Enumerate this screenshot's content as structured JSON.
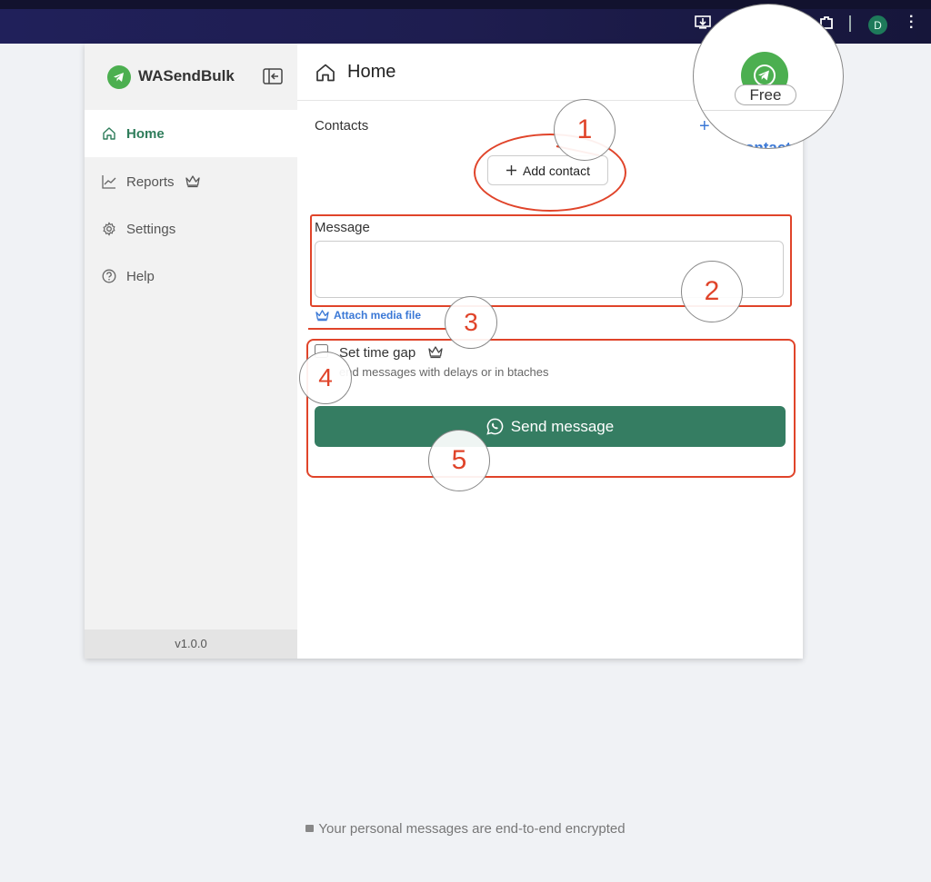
{
  "browser": {
    "avatar_initial": "D"
  },
  "sidebar": {
    "brand": "WASendBulk",
    "items": [
      {
        "label": "Home",
        "icon": "home-icon",
        "active": true
      },
      {
        "label": "Reports",
        "icon": "chart-icon",
        "premium": true
      },
      {
        "label": "Settings",
        "icon": "gear-icon"
      },
      {
        "label": "Help",
        "icon": "question-icon"
      }
    ],
    "version": "v1.0.0"
  },
  "main": {
    "title": "Home",
    "contacts_label": "Contacts",
    "add_contact_label": "Add contact",
    "message_label": "Message",
    "message_value": "",
    "attach_label": "Attach media file",
    "time_gap_label": "Set time gap",
    "time_gap_desc": "end messages with delays or in btaches",
    "send_label": "Send message"
  },
  "badge": {
    "label": "Free",
    "partial_link": "ontact"
  },
  "annotations": [
    "1",
    "2",
    "3",
    "4",
    "5"
  ],
  "footer": {
    "text": "Your personal messages are end-to-end encrypted"
  },
  "colors": {
    "accent_green": "#357d62",
    "brand_green": "#4caf50",
    "link_blue": "#3a78d6",
    "annotation_red": "#e0442a"
  }
}
